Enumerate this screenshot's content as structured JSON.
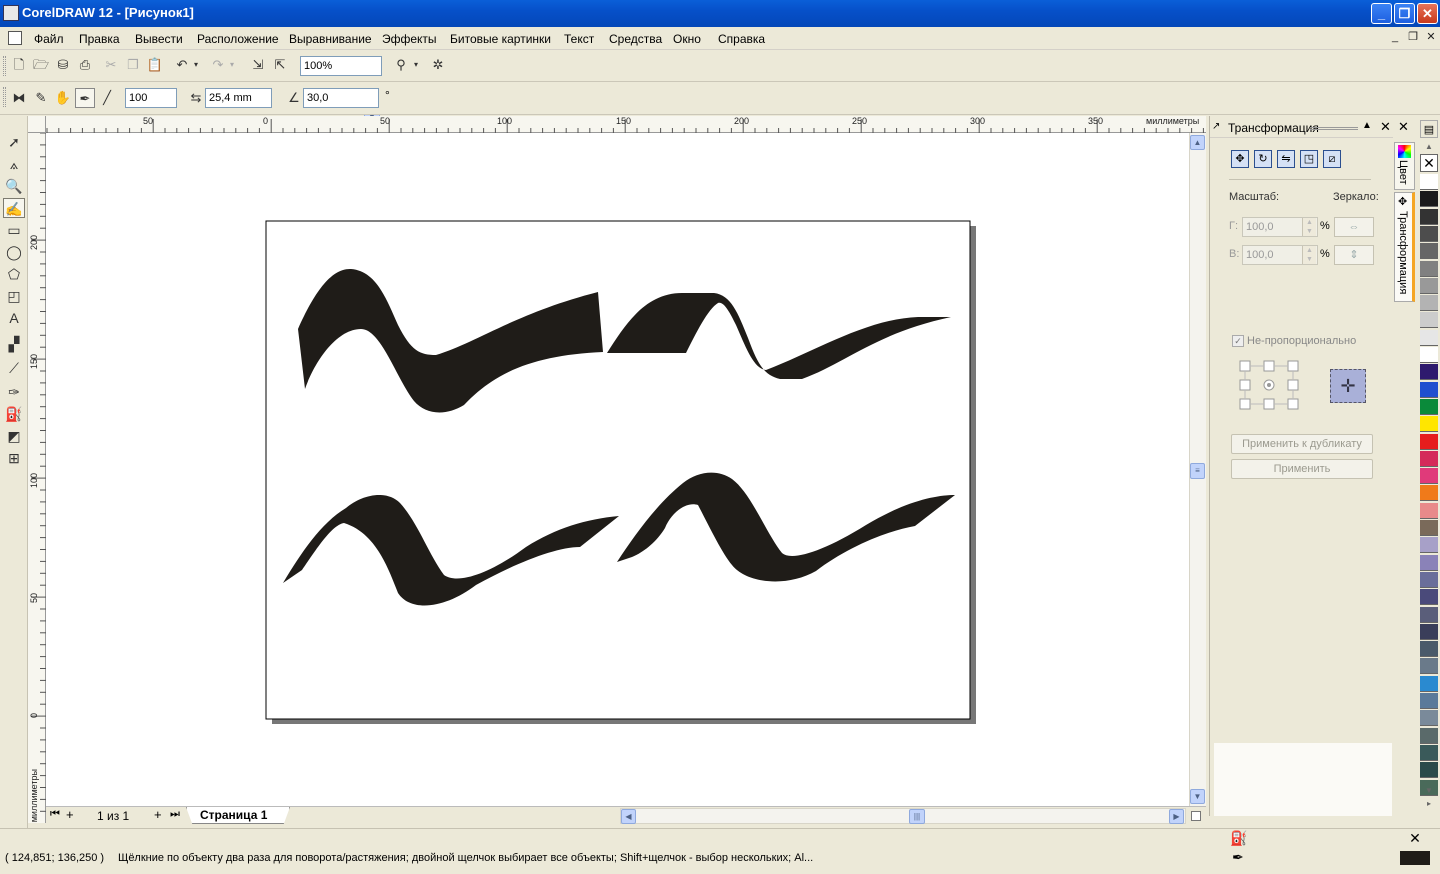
{
  "window": {
    "title": "CorelDRAW 12 - [Рисунок1]",
    "minimize": "_",
    "maximize": "❐",
    "close": "✕"
  },
  "menu": {
    "items": [
      "Файл",
      "Правка",
      "Вывести",
      "Расположение",
      "Выравнивание",
      "Эффекты",
      "Битовые картинки",
      "Текст",
      "Средства",
      "Окно",
      "Справка"
    ],
    "mdi": [
      "_",
      "❐",
      "✕"
    ]
  },
  "standard_toolbar": {
    "zoom": "100%",
    "icons": [
      "new-icon",
      "open-icon",
      "save-icon",
      "print-icon",
      "cut-icon",
      "copy-icon",
      "paste-icon",
      "undo-icon",
      "redo-icon",
      "import-icon",
      "export-icon",
      "app-launcher-icon",
      "corel-online-icon"
    ]
  },
  "property_bar": {
    "smoothing": "100",
    "width": "25,4 mm",
    "angle": "30,0",
    "degree_sign": "°"
  },
  "toolbox": {
    "tools": [
      "pick-tool-icon",
      "shape-tool-icon",
      "zoom-tool-icon",
      "artistic-media-tool-icon",
      "rectangle-tool-icon",
      "ellipse-tool-icon",
      "polygon-tool-icon",
      "basic-shapes-tool-icon",
      "text-tool-icon",
      "interactive-blend-tool-icon",
      "eyedropper-tool-icon",
      "outline-tool-icon",
      "fill-tool-icon",
      "interactive-fill-tool-icon",
      "mesh-fill-tool-icon"
    ]
  },
  "rulers": {
    "units": "миллиметры",
    "h_ticks": [
      "50",
      "0",
      "50",
      "100",
      "150",
      "200",
      "250",
      "300",
      "350"
    ],
    "v_ticks": [
      "200",
      "150",
      "100",
      "50",
      "0"
    ]
  },
  "page_nav": {
    "counter": "1 из 1",
    "page_tab": "Страница 1"
  },
  "docker": {
    "title": "Трансформация",
    "scale_label": "Масштаб:",
    "mirror_label": "Зеркало:",
    "h_label": "Г:",
    "v_label": "В:",
    "h_value": "100,0",
    "v_value": "100,0",
    "percent": "%",
    "nonproportional": "Не-пропорционально",
    "apply_dup": "Применить к дубликату",
    "apply": "Применить",
    "tab_color": "Цвет",
    "tab_transform": "Трансформация"
  },
  "palette": {
    "colors": [
      "#ffffff",
      "#1a1a1a",
      "#333333",
      "#4d4d4d",
      "#666666",
      "#808080",
      "#999999",
      "#b3b3b3",
      "#cccccc",
      "#e6e6e6",
      "#ffffff",
      "#2e1a6e",
      "#1f4fcf",
      "#0a8a3a",
      "#ffe600",
      "#e61d1d",
      "#d42a5a",
      "#e03a7a",
      "#f07a1a",
      "#e88a8a",
      "#7a6a5a",
      "#a7a0c8",
      "#8a82b8",
      "#6a6e9a",
      "#4a4a7a",
      "#5a5e7a",
      "#3a3e5a",
      "#4a5a6a",
      "#6a7a8a",
      "#2a8ad0",
      "#5a7a9a",
      "#7a8a9a",
      "#5a6a6a",
      "#3a5a5a",
      "#2a4a4a",
      "#4a6a5a"
    ]
  },
  "status": {
    "coords": "( 124,851; 136,250 )",
    "message": "Щёлкние по объекту два раза для поворота/растяжения; двойной щелчок выбирает все объекты; Shift+щелчок - выбор нескольких; Al..."
  }
}
